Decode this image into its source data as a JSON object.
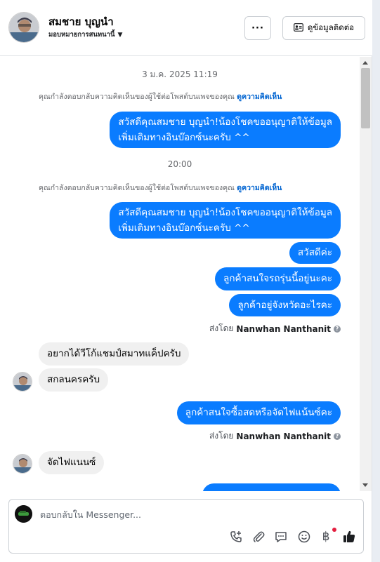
{
  "header": {
    "contact_name": "สมชาย บุญนำ",
    "assign_label": "มอบหมายการสนทนานี้",
    "more_label": "···",
    "contact_info_label": "ดูข้อมูลติดต่อ"
  },
  "thread": {
    "timestamp_1": "3 ม.ค. 2025 11:19",
    "timestamp_2": "20:00",
    "notice_text": "คุณกำลังตอบกลับความคิดเห็นของผู้ใช้ต่อโพสต์บนเพจของคุณ",
    "notice_link": "ดูความคิดเห็น",
    "out_msg_1_line1": "สวัสดีคุณสมชาย บุญนำ!น้องโชคขออนุญาติให้ข้อมูล",
    "out_msg_1_line2": "เพิ่มเติมทางอินบ๊อกซ์นะครับ ^^",
    "out_msg_2_line1": "สวัสดีคุณสมชาย บุญนำ!น้องโชคขออนุญาติให้ข้อมูล",
    "out_msg_2_line2": "เพิ่มเติมทางอินบ๊อกซ์นะครับ ^^",
    "out_msg_3": "สวัสดีค่ะ",
    "out_msg_4": "ลูกค้าสนใจรถรุ่นนี้อยู่นะคะ",
    "out_msg_5": "ลูกค้าอยู่จังหวัดอะไรคะ",
    "sent_by_label": "ส่งโดย",
    "sent_by_name": "Nanwhan Nanthanit",
    "in_msg_1": "อยากได้วีโก้แชมป์สมาทแค็ปครับ",
    "in_msg_2": "สกลนครครับ",
    "out_msg_6": "ลูกค้าสนใจซื้อสดหรือจัดไฟแน้นซ์คะ",
    "in_msg_3": "จัดไฟแนนซ์"
  },
  "composer": {
    "placeholder": "ตอบกลับใน Messenger...",
    "baht_symbol": "฿"
  },
  "icons": {
    "call": "phone-plus-icon",
    "attach": "paperclip-icon",
    "saved_replies": "chat-bubble-icon",
    "emoji": "smiley-icon",
    "payment": "baht-icon",
    "like": "thumbs-up-icon"
  },
  "colors": {
    "outgoing_bubble": "#0a7cff",
    "incoming_bubble": "#f0f0f0",
    "link": "#0064d1",
    "notification_dot": "#e41e3f"
  }
}
